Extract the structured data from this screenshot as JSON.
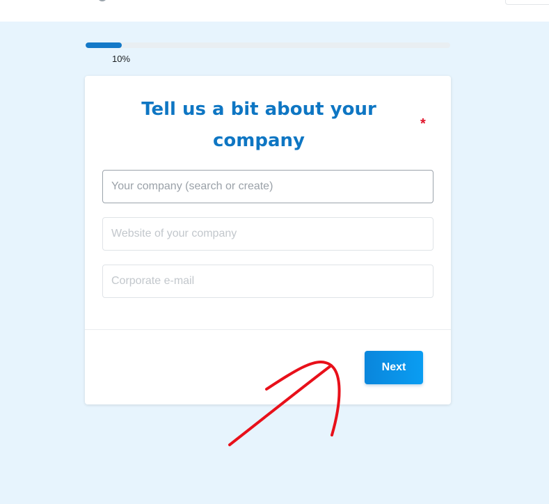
{
  "progress": {
    "percent": 10,
    "label": "10%"
  },
  "form": {
    "title": "Tell us a bit about your company",
    "required_marker": "*",
    "fields": {
      "company": {
        "placeholder": "Your company (search or create)",
        "value": ""
      },
      "website": {
        "placeholder": "Website of your company",
        "value": ""
      },
      "email": {
        "placeholder": "Corporate e-mail",
        "value": ""
      }
    },
    "next_label": "Next"
  },
  "colors": {
    "background": "#e7f4fd",
    "accent": "#0e76c3",
    "button": "#0a86dc",
    "required": "#e0142a",
    "annotation": "#e8101a"
  },
  "icons": {
    "annotation": "red-hand-drawn-arrow"
  }
}
